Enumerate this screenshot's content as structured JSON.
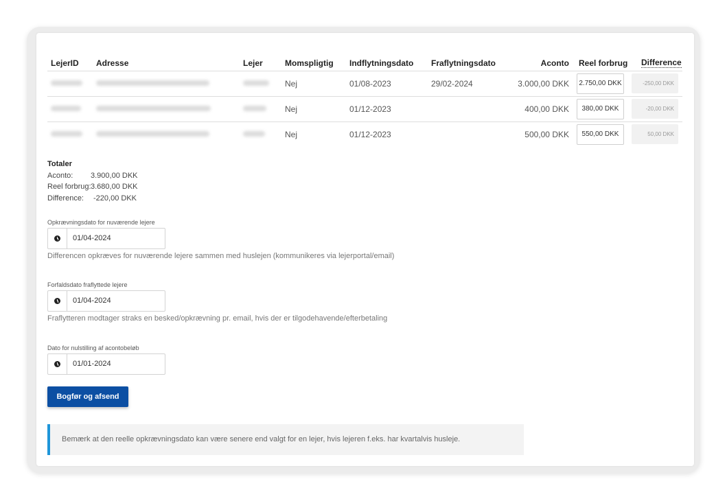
{
  "table": {
    "headers": {
      "lejerid": "LejerID",
      "adresse": "Adresse",
      "lejer": "Lejer",
      "momspligtig": "Momspligtig",
      "indflytning": "Indflytningsdato",
      "fraflytning": "Fraflytningsdato",
      "aconto": "Aconto",
      "reel": "Reel forbrug",
      "difference": "Difference"
    },
    "rows": [
      {
        "moms": "Nej",
        "indflytning": "01/08-2023",
        "fraflytning": "29/02-2024",
        "aconto": "3.000,00 DKK",
        "reel": "2.750,00 DKK",
        "difference": "-250,00 DKK"
      },
      {
        "moms": "Nej",
        "indflytning": "01/12-2023",
        "fraflytning": "",
        "aconto": "400,00 DKK",
        "reel": "380,00 DKK",
        "difference": "-20,00 DKK"
      },
      {
        "moms": "Nej",
        "indflytning": "01/12-2023",
        "fraflytning": "",
        "aconto": "500,00 DKK",
        "reel": "550,00 DKK",
        "difference": "50,00 DKK"
      }
    ]
  },
  "totals": {
    "title": "Totaler",
    "aconto_label": "Aconto:",
    "aconto_value": "3.900,00 DKK",
    "reel_label": "Reel forbrug:",
    "reel_value": "3.680,00 DKK",
    "diff_label": "Difference:",
    "diff_value": "-220,00 DKK"
  },
  "fields": {
    "opkraevning": {
      "label": "Opkrævningsdato for nuværende lejere",
      "value": "01/04-2024",
      "help": "Differencen opkræves for nuværende lejere sammen med huslejen (kommunikeres via lejerportal/email)"
    },
    "forfald": {
      "label": "Forfaldsdato fraflyttede lejere",
      "value": "01/04-2024",
      "help": "Fraflytteren modtager straks en besked/opkrævning pr. email, hvis der er tilgodehavende/efterbetaling"
    },
    "nulstilling": {
      "label": "Dato for nulstilling af acontobeløb",
      "value": "01/01-2024"
    }
  },
  "submit_label": "Bogfør og afsend",
  "note": "Bemærk at den reelle opkrævningsdato kan være senere end valgt for en lejer, hvis lejeren f.eks. har kvartalvis husleje.",
  "colors": {
    "primary": "#0c4fa3",
    "note_accent": "#1e96d9"
  }
}
